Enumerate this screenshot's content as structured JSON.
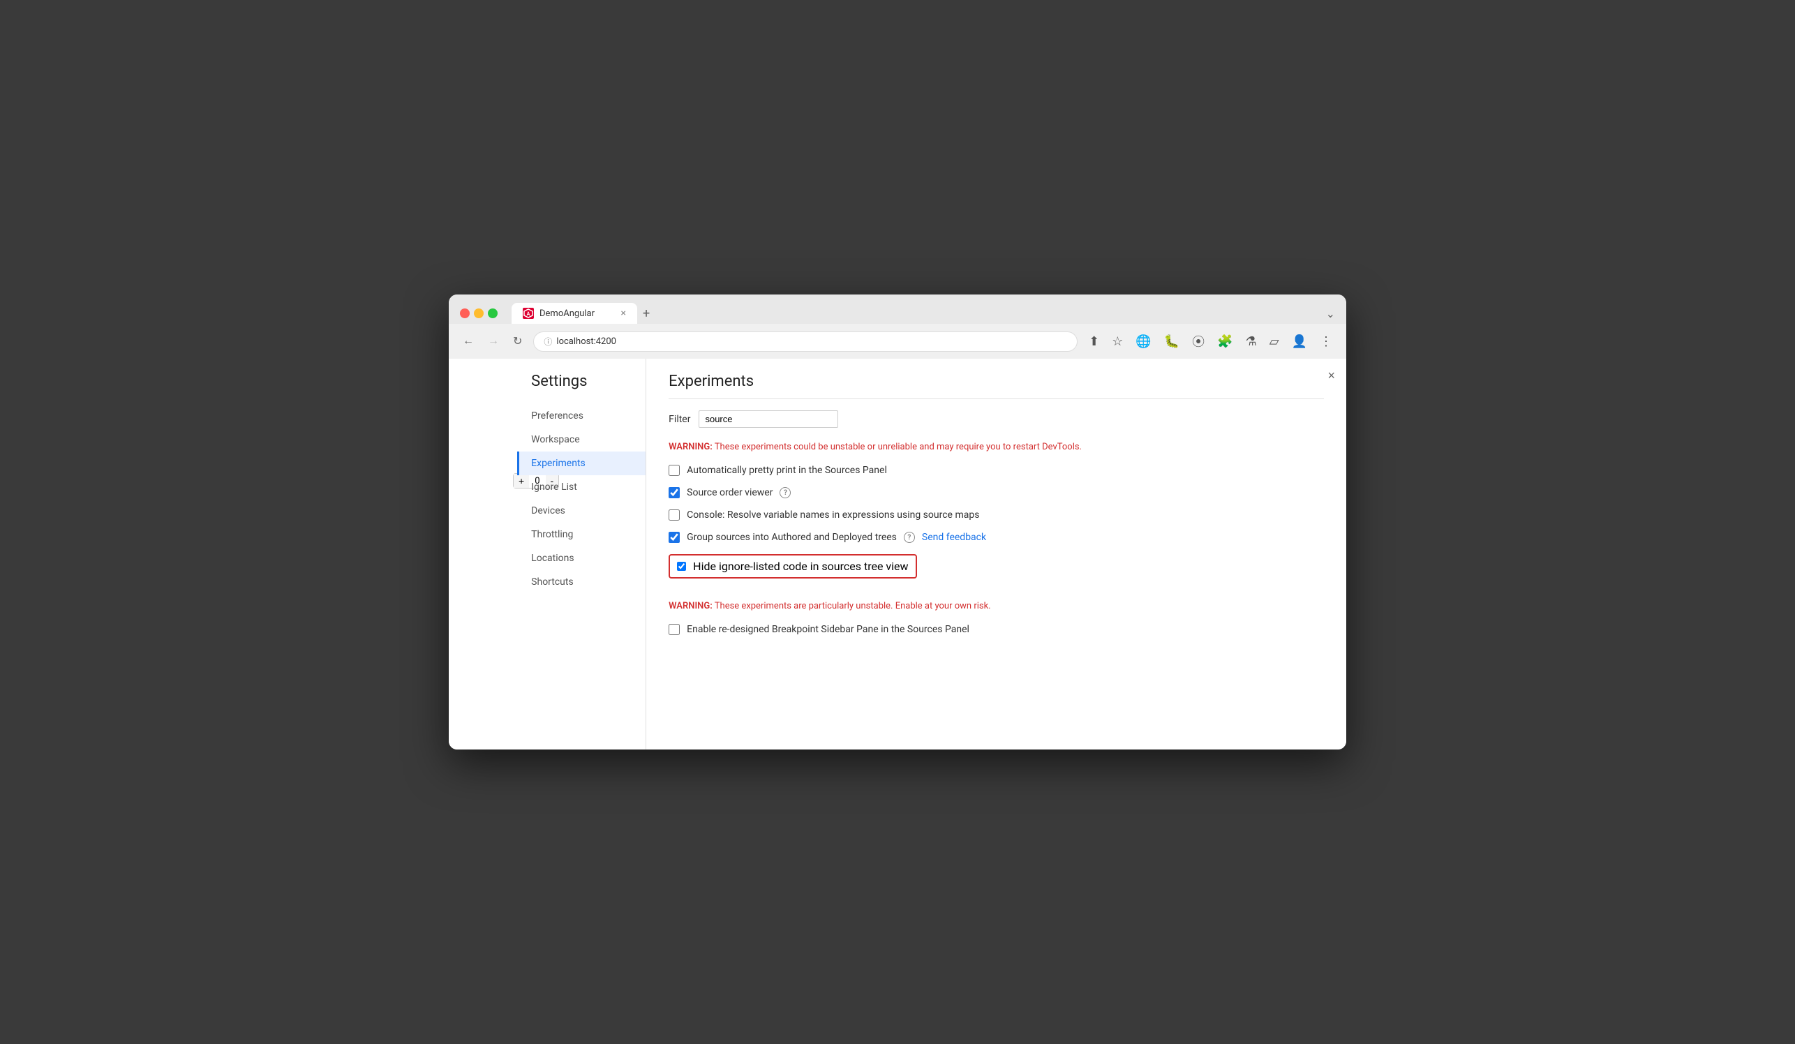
{
  "browser": {
    "tab_title": "DemoAngular",
    "tab_close": "×",
    "tab_new": "+",
    "address": "localhost:4200",
    "address_icon": "ⓘ",
    "nav_back": "←",
    "nav_forward": "→",
    "nav_refresh": "↻",
    "window_menu": "⌄"
  },
  "counter": {
    "minus": "-",
    "value": "0",
    "plus": "+"
  },
  "settings": {
    "title": "Settings",
    "close": "×",
    "nav_items": [
      {
        "id": "preferences",
        "label": "Preferences",
        "active": false
      },
      {
        "id": "workspace",
        "label": "Workspace",
        "active": false
      },
      {
        "id": "experiments",
        "label": "Experiments",
        "active": true
      },
      {
        "id": "ignore-list",
        "label": "Ignore List",
        "active": false
      },
      {
        "id": "devices",
        "label": "Devices",
        "active": false
      },
      {
        "id": "throttling",
        "label": "Throttling",
        "active": false
      },
      {
        "id": "locations",
        "label": "Locations",
        "active": false
      },
      {
        "id": "shortcuts",
        "label": "Shortcuts",
        "active": false
      }
    ]
  },
  "experiments": {
    "title": "Experiments",
    "filter_label": "Filter",
    "filter_value": "source",
    "filter_placeholder": "Filter",
    "warning1": "These experiments could be unstable or unreliable and may require you to restart DevTools.",
    "warning1_label": "WARNING:",
    "items": [
      {
        "id": "pretty-print",
        "label": "Automatically pretty print in the Sources Panel",
        "checked": false,
        "has_help": false,
        "has_feedback": false,
        "highlighted": false
      },
      {
        "id": "source-order",
        "label": "Source order viewer",
        "checked": true,
        "has_help": true,
        "has_feedback": false,
        "highlighted": false
      },
      {
        "id": "resolve-vars",
        "label": "Console: Resolve variable names in expressions using source maps",
        "checked": false,
        "has_help": false,
        "has_feedback": false,
        "highlighted": false
      },
      {
        "id": "group-sources",
        "label": "Group sources into Authored and Deployed trees",
        "checked": true,
        "has_help": true,
        "has_feedback": true,
        "feedback_label": "Send feedback",
        "highlighted": false
      },
      {
        "id": "hide-ignore",
        "label": "Hide ignore-listed code in sources tree view",
        "checked": true,
        "has_help": false,
        "has_feedback": false,
        "highlighted": true
      }
    ],
    "warning2": "These experiments are particularly unstable. Enable at your own risk.",
    "warning2_label": "WARNING:",
    "items2": [
      {
        "id": "redesigned-breakpoint",
        "label": "Enable re-designed Breakpoint Sidebar Pane in the Sources Panel",
        "checked": false,
        "highlighted": false
      }
    ]
  }
}
